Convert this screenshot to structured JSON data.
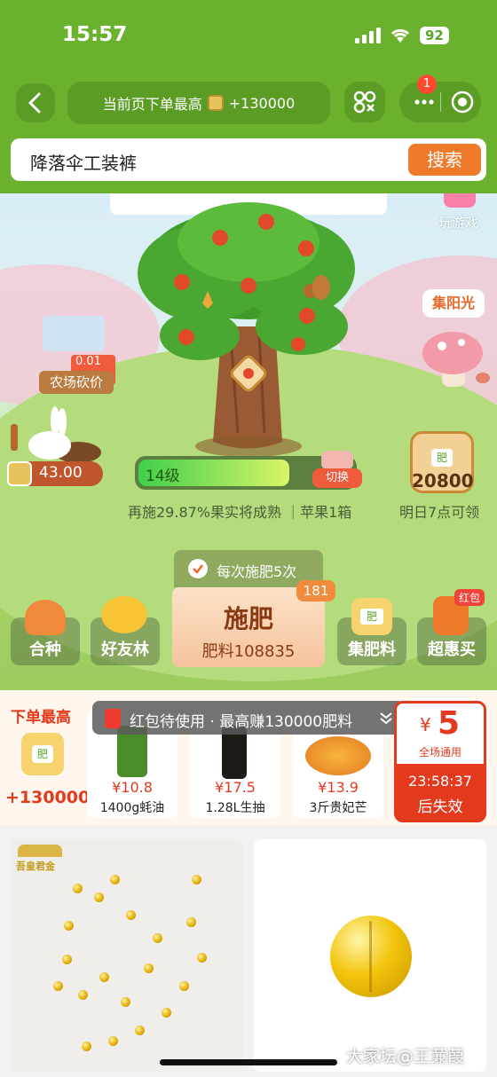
{
  "status_bar": {
    "time": "15:57",
    "battery": "92"
  },
  "nav": {
    "title_prefix": "当前页下单最高",
    "title_reward": "+130000",
    "capsule_badge": "1"
  },
  "search": {
    "value": "降落伞工装裤",
    "button": "搜索"
  },
  "scene": {
    "play_game_label": "玩游戏",
    "sunshine_label": "集阳光",
    "bargain_price": "0.01元",
    "bargain_label": "农场砍价",
    "balance": "43.00",
    "level": "14级",
    "switch_label": "切换",
    "progress_text": "再施29.87%果实将成熟 ｜苹果1箱",
    "level_progress": 0.7013,
    "bag_label": "肥",
    "bag_amount": "20800",
    "bag_caption": "明日7点可领",
    "fertilize_times_label": "每次施肥5次",
    "fertilize_count_badge": "181",
    "fertilize_button": "施肥",
    "fertilizer_amount": "肥料108835"
  },
  "actions": [
    {
      "label": "合种"
    },
    {
      "label": "好友林"
    },
    {
      "label": "集肥料",
      "icon_text": "肥"
    },
    {
      "label": "超惠买",
      "tag": "红包"
    }
  ],
  "shop": {
    "header": "下单最高",
    "bag_label": "肥",
    "reward": "+130000",
    "banner": "红包待使用 · 最高赚130000肥料",
    "products": [
      {
        "price": "¥10.8",
        "name": "1400g蚝油"
      },
      {
        "price": "¥17.5",
        "name": "1.28L生抽"
      },
      {
        "price": "¥13.9",
        "name": "3斤贵妃芒"
      }
    ],
    "coupon": {
      "currency": "¥",
      "amount": "5",
      "scope": "全场通用",
      "countdown": "23:58:37",
      "expire_label": "后失效"
    }
  },
  "feed": {
    "brand_logo_text": "吾皇君金"
  },
  "watermark": "大家坛@王蒹葭"
}
